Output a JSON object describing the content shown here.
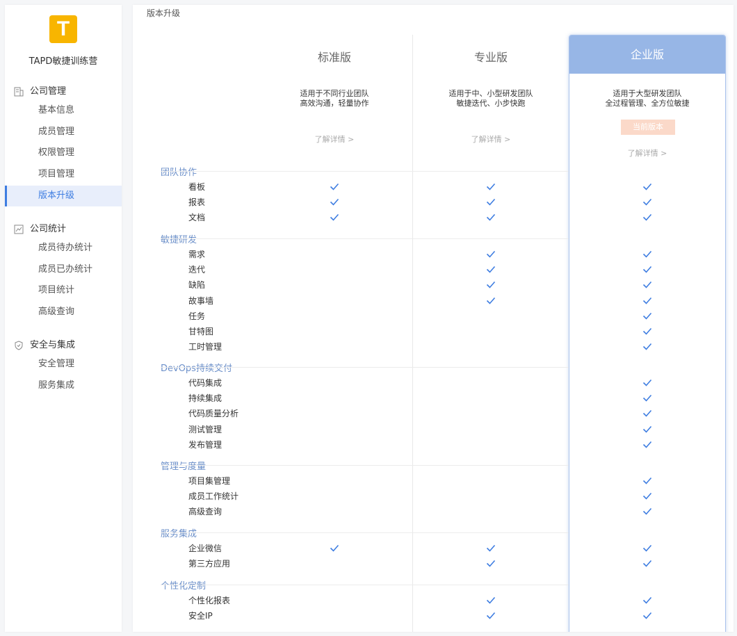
{
  "sidebar": {
    "logo_letter": "T",
    "brand": "TAPD敏捷训练营",
    "groups": [
      {
        "title": "公司管理",
        "icon": "company-icon",
        "items": [
          "基本信息",
          "成员管理",
          "权限管理",
          "项目管理",
          "版本升级"
        ]
      },
      {
        "title": "公司统计",
        "icon": "chart-icon",
        "items": [
          "成员待办统计",
          "成员已办统计",
          "项目统计",
          "高级查询"
        ]
      },
      {
        "title": "安全与集成",
        "icon": "shield-icon",
        "items": [
          "安全管理",
          "服务集成"
        ]
      }
    ],
    "active_item": "版本升级"
  },
  "page": {
    "title": "版本升级"
  },
  "plans": [
    {
      "name": "标准版",
      "desc1": "适用于不同行业团队",
      "desc2": "高效沟通，轻量协作",
      "link": "了解详情 >"
    },
    {
      "name": "专业版",
      "desc1": "适用于中、小型研发团队",
      "desc2": "敏捷迭代、小步快跑",
      "link": "了解详情 >"
    },
    {
      "name": "企业版",
      "desc1": "适用于大型研发团队",
      "desc2": "全过程管理、全方位敏捷",
      "link": "了解详情 >",
      "badge": "当前版本"
    }
  ],
  "categories": [
    {
      "name": "团队协作",
      "features": [
        {
          "name": "看板",
          "std": true,
          "pro": true,
          "ent": true
        },
        {
          "name": "报表",
          "std": true,
          "pro": true,
          "ent": true
        },
        {
          "name": "文档",
          "std": true,
          "pro": true,
          "ent": true
        }
      ]
    },
    {
      "name": "敏捷研发",
      "features": [
        {
          "name": "需求",
          "std": false,
          "pro": true,
          "ent": true
        },
        {
          "name": "迭代",
          "std": false,
          "pro": true,
          "ent": true
        },
        {
          "name": "缺陷",
          "std": false,
          "pro": true,
          "ent": true
        },
        {
          "name": "故事墙",
          "std": false,
          "pro": true,
          "ent": true
        },
        {
          "name": "任务",
          "std": false,
          "pro": false,
          "ent": true
        },
        {
          "name": "甘特图",
          "std": false,
          "pro": false,
          "ent": true
        },
        {
          "name": "工时管理",
          "std": false,
          "pro": false,
          "ent": true
        }
      ]
    },
    {
      "name": "DevOps持续交付",
      "features": [
        {
          "name": "代码集成",
          "std": false,
          "pro": false,
          "ent": true
        },
        {
          "name": "持续集成",
          "std": false,
          "pro": false,
          "ent": true
        },
        {
          "name": "代码质量分析",
          "std": false,
          "pro": false,
          "ent": true
        },
        {
          "name": "测试管理",
          "std": false,
          "pro": false,
          "ent": true
        },
        {
          "name": "发布管理",
          "std": false,
          "pro": false,
          "ent": true
        }
      ]
    },
    {
      "name": "管理与度量",
      "features": [
        {
          "name": "项目集管理",
          "std": false,
          "pro": false,
          "ent": true
        },
        {
          "name": "成员工作统计",
          "std": false,
          "pro": false,
          "ent": true
        },
        {
          "name": "高级查询",
          "std": false,
          "pro": false,
          "ent": true
        }
      ]
    },
    {
      "name": "服务集成",
      "features": [
        {
          "name": "企业微信",
          "std": true,
          "pro": true,
          "ent": true
        },
        {
          "name": "第三方应用",
          "std": false,
          "pro": true,
          "ent": true
        }
      ]
    },
    {
      "name": "个性化定制",
      "features": [
        {
          "name": "个性化报表",
          "std": false,
          "pro": true,
          "ent": true
        },
        {
          "name": "安全IP",
          "std": false,
          "pro": true,
          "ent": true
        }
      ]
    }
  ],
  "colors": {
    "accent": "#3e7de1",
    "check": "#3e7de1",
    "enterprise_header": "#97b6e6",
    "badge": "#fbd9c9"
  }
}
